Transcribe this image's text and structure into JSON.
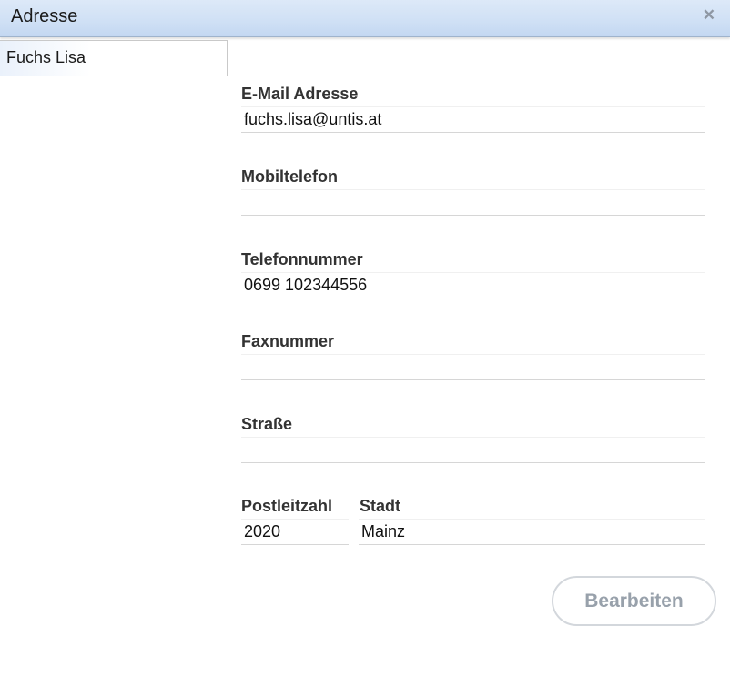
{
  "window": {
    "title": "Adresse",
    "close_icon": "close-icon"
  },
  "sidebar": {
    "items": [
      {
        "label": "Fuchs Lisa"
      }
    ]
  },
  "form": {
    "email": {
      "label": "E-Mail Adresse",
      "value": "fuchs.lisa@untis.at"
    },
    "mobile": {
      "label": "Mobiltelefon",
      "value": ""
    },
    "phone": {
      "label": "Telefonnummer",
      "value": "0699 102344556"
    },
    "fax": {
      "label": "Faxnummer",
      "value": ""
    },
    "street": {
      "label": "Straße",
      "value": ""
    },
    "zip": {
      "label": "Postleitzahl",
      "value": "2020"
    },
    "city": {
      "label": "Stadt",
      "value": "Mainz"
    }
  },
  "actions": {
    "edit_label": "Bearbeiten"
  }
}
